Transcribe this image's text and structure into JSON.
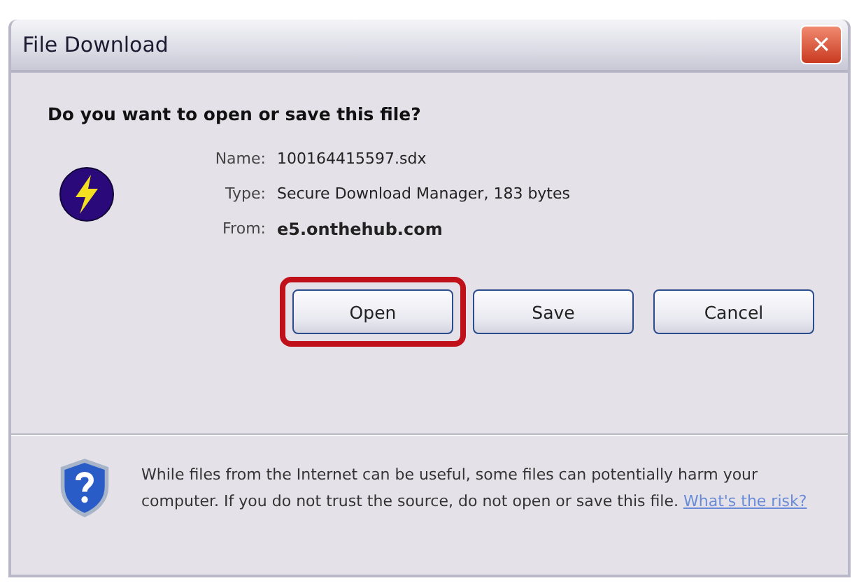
{
  "window": {
    "title": "File Download",
    "close_label": "×"
  },
  "question": "Do you want to open or save this file?",
  "details": [
    {
      "label": "Name:",
      "value": "100164415597.sdx",
      "bold": false
    },
    {
      "label": "Type:",
      "value": "Secure Download Manager, 183 bytes",
      "bold": false
    },
    {
      "label": "From:",
      "value": "e5.onthehub.com",
      "bold": true
    }
  ],
  "buttons": [
    {
      "label": "Open",
      "highlighted": true
    },
    {
      "label": "Save",
      "highlighted": false
    },
    {
      "label": "Cancel",
      "highlighted": false
    }
  ],
  "warning": {
    "text": "While files from the Internet can be useful, some files can potentially harm your computer. If you do not trust the source, do not open or save this file.",
    "link": "What's the risk?"
  }
}
